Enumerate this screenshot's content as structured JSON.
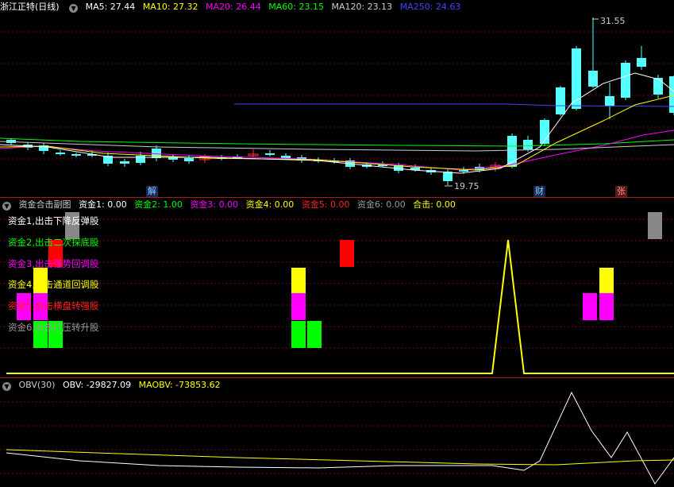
{
  "main": {
    "title": "浙江正特(日线)",
    "ma": [
      {
        "label": "MA5: 27.44",
        "color": "#ffffff"
      },
      {
        "label": "MA10: 27.32",
        "color": "#ffff00"
      },
      {
        "label": "MA20: 26.44",
        "color": "#ff00ff"
      },
      {
        "label": "MA60: 23.15",
        "color": "#00ff00"
      },
      {
        "label": "MA120: 23.13",
        "color": "#cccccc"
      },
      {
        "label": "MA250: 24.63",
        "color": "#4444ff"
      }
    ],
    "high_label": "31.55",
    "low_label": "19.75",
    "events": [
      {
        "label": "解",
        "color": "#55aaff"
      },
      {
        "label": "财",
        "color": "#55aaff"
      },
      {
        "label": "张",
        "color": "#ff5555"
      }
    ]
  },
  "sub": {
    "title": "资金合击副图",
    "vals": [
      {
        "label": "资金1: 0.00",
        "color": "#ffffff"
      },
      {
        "label": "资金2: 1.00",
        "color": "#00ff00"
      },
      {
        "label": "资金3: 0.00",
        "color": "#ff00ff"
      },
      {
        "label": "资金4: 0.00",
        "color": "#ffff00"
      },
      {
        "label": "资金5: 0.00",
        "color": "#ff2020"
      },
      {
        "label": "资金6: 0.00",
        "color": "#999999"
      },
      {
        "label": "合击: 0.00",
        "color": "#ffff00"
      }
    ],
    "labels": [
      {
        "text": "资金1,出击下降反弹股",
        "color": "#ffffff"
      },
      {
        "text": "资金2,出击二次探底股",
        "color": "#00ff00"
      },
      {
        "text": "资金3,出击强势回调股",
        "color": "#ff00ff"
      },
      {
        "text": "资金4,出击通道回调股",
        "color": "#ffff00"
      },
      {
        "text": "资金5,出击横盘转强股",
        "color": "#ff2020"
      },
      {
        "text": "资金6,出击打压转升股",
        "color": "#999999"
      }
    ]
  },
  "obv": {
    "title": "OBV(30)",
    "obv": "OBV: -29827.09",
    "maobv": "MAOBV: -73853.62"
  },
  "colors": {
    "up": "#ff3333",
    "down": "#55ffff",
    "grid": "#7a0d0d",
    "s1": "#888888",
    "s2": "#00ff00",
    "s3": "#ff00ff",
    "s4": "#ffff00",
    "s5": "#ff0000",
    "s6": "#888888"
  }
}
